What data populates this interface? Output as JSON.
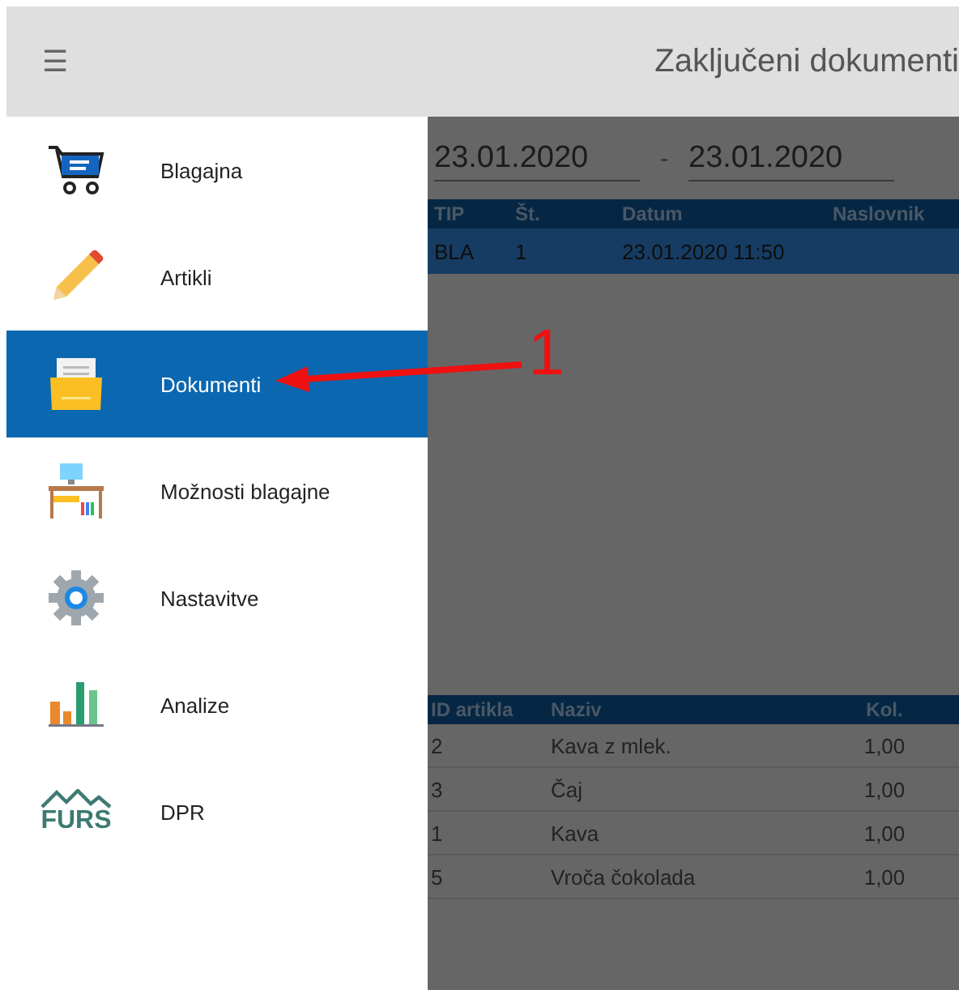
{
  "app_bar": {
    "title": "Zaključeni dokumenti",
    "menu_icon": "☰"
  },
  "drawer": {
    "items": [
      {
        "kind": "cart",
        "label": "Blagajna",
        "selected": false
      },
      {
        "kind": "pencil",
        "label": "Artikli",
        "selected": false
      },
      {
        "kind": "folder",
        "label": "Dokumenti",
        "selected": true
      },
      {
        "kind": "desk",
        "label": "Možnosti blagajne",
        "selected": false
      },
      {
        "kind": "gear",
        "label": "Nastavitve",
        "selected": false
      },
      {
        "kind": "chart",
        "label": "Analize",
        "selected": false
      },
      {
        "kind": "furs",
        "label": "DPR",
        "selected": false,
        "logo_text": "FURS"
      }
    ]
  },
  "date_range": {
    "from": "23.01.2020",
    "separator": "-",
    "to": "23.01.2020"
  },
  "documents_table": {
    "columns": [
      "TIP",
      "Št.",
      "Datum",
      "Naslovnik"
    ],
    "rows": [
      {
        "cells": [
          "BLA",
          "1",
          "23.01.2020 11:50",
          ""
        ],
        "selected": true
      }
    ]
  },
  "items_table": {
    "columns": [
      "ID artikla",
      "Naziv",
      "Kol."
    ],
    "rows": [
      [
        "2",
        "Kava z mlek.",
        "1,00"
      ],
      [
        "3",
        "Čaj",
        "1,00"
      ],
      [
        "1",
        "Kava",
        "1,00"
      ],
      [
        "5",
        "Vroča čokolada",
        "1,00"
      ]
    ]
  },
  "annotation": {
    "label": "1"
  }
}
